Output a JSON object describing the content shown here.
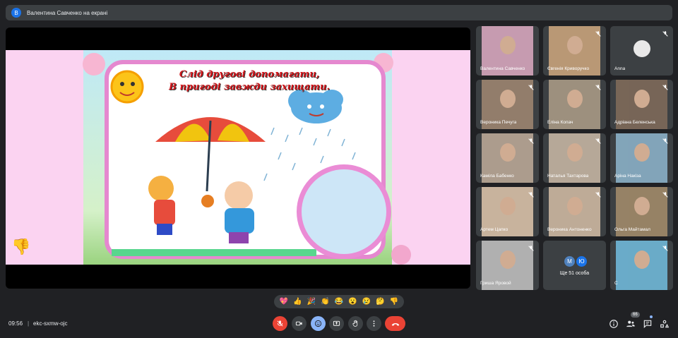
{
  "presenter": {
    "initial": "В",
    "label": "Валентина Савченко на екрані"
  },
  "slide": {
    "title_line1": "Слід другові допомагати,",
    "title_line2": "В пригоді завжди захищати."
  },
  "participants": [
    {
      "name": "Валентина Савченко",
      "muted": false,
      "photo": true
    },
    {
      "name": "Євгенія Криворучко",
      "muted": true,
      "photo": true
    },
    {
      "name": "Anna",
      "muted": true,
      "photo": false
    },
    {
      "name": "Вероника Печуга",
      "muted": true,
      "photo": true
    },
    {
      "name": "Еліна Копач",
      "muted": true,
      "photo": true
    },
    {
      "name": "Адріана Беленська",
      "muted": true,
      "photo": true
    },
    {
      "name": "Каміла Бабенко",
      "muted": true,
      "photo": true
    },
    {
      "name": "Наталья Тахтарова",
      "muted": true,
      "photo": true
    },
    {
      "name": "Аріна Накіза",
      "muted": true,
      "photo": true
    },
    {
      "name": "Артем Цапко",
      "muted": true,
      "photo": true
    },
    {
      "name": "Вероника Антоненко",
      "muted": true,
      "photo": true
    },
    {
      "name": "Ольга Майтамал",
      "muted": true,
      "photo": true
    },
    {
      "name": "Гриша Яровой",
      "muted": true,
      "photo": true
    },
    {
      "name": "",
      "muted": false,
      "photo": false
    },
    {
      "name": "С",
      "muted": true,
      "photo": true
    }
  ],
  "more_people": {
    "initials": [
      "М",
      "Ю"
    ],
    "label": "Ще 51 особа"
  },
  "reactions": [
    "💖",
    "👍",
    "🎉",
    "👏",
    "😂",
    "😮",
    "😢",
    "🤔",
    "👎"
  ],
  "bottom": {
    "time": "09:56",
    "separator": "|",
    "meeting_code": "ekc-sxmw-ojc",
    "participants_count": "66"
  },
  "colors": {
    "background": "#202124",
    "tile": "#3c4043",
    "danger": "#ea4335",
    "accent": "#8ab4f8"
  }
}
